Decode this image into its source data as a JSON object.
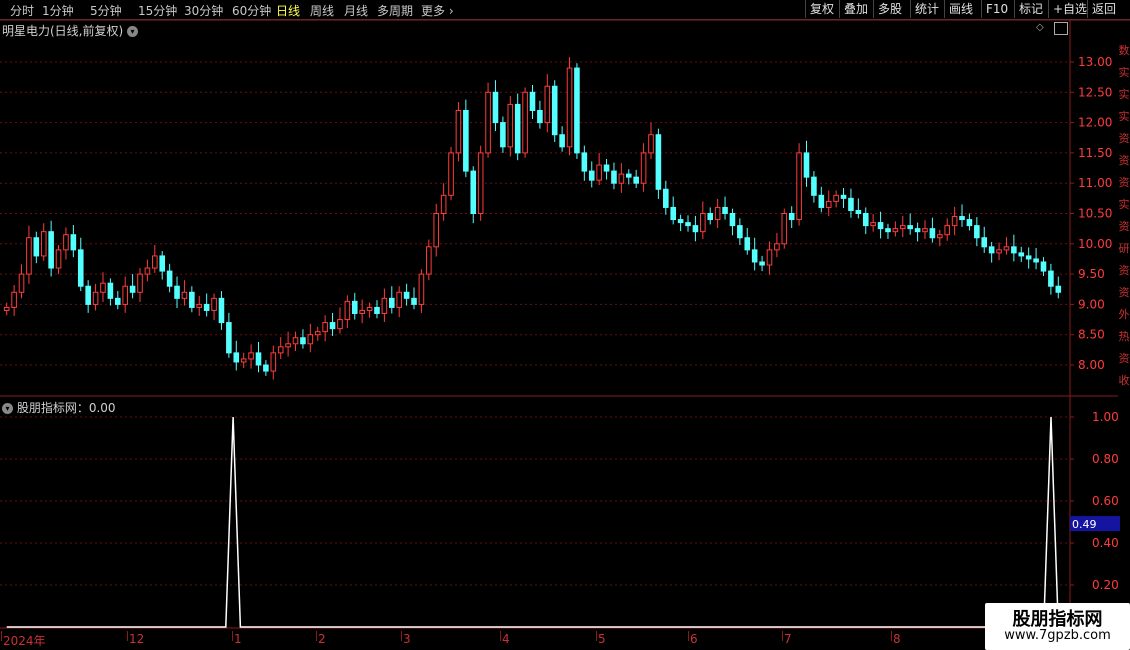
{
  "toolbar": {
    "periods": [
      "分时",
      "1分钟",
      "5分钟",
      "15分钟",
      "30分钟",
      "60分钟",
      "日线",
      "周线",
      "月线",
      "多周期",
      "更多"
    ],
    "active_period": "日线",
    "more_chevron": "›",
    "buttons": [
      "复权",
      "叠加",
      "多股",
      "统计",
      "画线",
      "F10",
      "标记",
      "+自选",
      "返回"
    ]
  },
  "main_chart": {
    "title": "明星电力(日线,前复权)",
    "price_axis": [
      "13.00",
      "12.50",
      "12.00",
      "11.50",
      "11.00",
      "10.50",
      "10.00",
      "9.50",
      "9.00",
      "8.50",
      "8.00"
    ]
  },
  "indicator": {
    "title": "股朋指标网：0.00",
    "axis": [
      "1.00",
      "0.80",
      "0.60",
      "0.40",
      "0.20"
    ],
    "cursor_value": "0.49"
  },
  "dates": [
    "2024年",
    "12",
    "1",
    "2",
    "3",
    "4",
    "5",
    "6",
    "7",
    "8"
  ],
  "watermark": {
    "line1": "股朋指标网",
    "line2": "www.7gpzb.com"
  },
  "right_strip": [
    "数",
    "实",
    "实",
    "实",
    "资",
    "资",
    "资",
    "实",
    "资",
    "研",
    "资",
    "资",
    "外",
    "热",
    "资",
    "收"
  ],
  "colors": {
    "up": "#ff3c3c",
    "down": "#54ffff",
    "grid": "#6a1010",
    "axis": "#8b1a1a",
    "signal": "#ffffff"
  },
  "chart_data": [
    {
      "type": "line",
      "series": [
        {
          "name": "close",
          "values": [
            8.95,
            9.2,
            9.5,
            10.1,
            9.8,
            10.2,
            9.6,
            9.9,
            10.15,
            9.9,
            9.3,
            9.0,
            9.2,
            9.35,
            9.1,
            9.0,
            9.3,
            9.2,
            9.5,
            9.6,
            9.8,
            9.55,
            9.3,
            9.1,
            9.2,
            8.95,
            9.0,
            8.9,
            9.1,
            8.7,
            8.2,
            8.05,
            8.1,
            8.2,
            8.0,
            7.9,
            8.2,
            8.3,
            8.35,
            8.45,
            8.35,
            8.5,
            8.55,
            8.7,
            8.6,
            8.75,
            9.05,
            8.85,
            8.9,
            8.95,
            8.85,
            9.1,
            8.95,
            9.2,
            9.1,
            9.0,
            9.5,
            9.95,
            10.5,
            10.8,
            11.5,
            12.2,
            11.2,
            10.5,
            11.5,
            12.5,
            12.0,
            11.6,
            12.3,
            11.5,
            12.5,
            12.2,
            12.0,
            12.6,
            11.8,
            11.6,
            12.9,
            11.5,
            11.2,
            11.05,
            11.3,
            11.2,
            11.0,
            11.15,
            11.1,
            11.0,
            11.5,
            11.8,
            10.9,
            10.6,
            10.4,
            10.35,
            10.3,
            10.2,
            10.5,
            10.4,
            10.6,
            10.5,
            10.3,
            10.1,
            9.9,
            9.7,
            9.65,
            9.9,
            10.0,
            10.5,
            10.4,
            11.5,
            11.1,
            10.8,
            10.6,
            10.7,
            10.8,
            10.75,
            10.55,
            10.5,
            10.3,
            10.35,
            10.25,
            10.2,
            10.25,
            10.3,
            10.25,
            10.2,
            10.25,
            10.1,
            10.15,
            10.3,
            10.45,
            10.4,
            10.3,
            10.1,
            9.95,
            9.85,
            9.9,
            9.95,
            9.85,
            9.8,
            9.75,
            9.7,
            9.55,
            9.3,
            9.2
          ]
        }
      ],
      "ylim": [
        7.8,
        13.3
      ]
    },
    {
      "type": "line",
      "series": [
        {
          "name": "股朋指标网",
          "values": [
            0,
            0,
            0,
            0,
            0,
            0,
            0,
            0,
            0,
            0,
            0,
            0,
            0,
            0,
            0,
            0,
            0,
            0,
            0,
            0,
            0,
            0,
            0,
            0,
            0,
            0,
            0,
            0,
            0,
            0,
            0,
            1,
            0,
            0,
            0,
            0,
            0,
            0,
            0,
            0,
            0,
            0,
            0,
            0,
            0,
            0,
            0,
            0,
            0,
            0,
            0,
            0,
            0,
            0,
            0,
            0,
            0,
            0,
            0,
            0,
            0,
            0,
            0,
            0,
            0,
            0,
            0,
            0,
            0,
            0,
            0,
            0,
            0,
            0,
            0,
            0,
            0,
            0,
            0,
            0,
            0,
            0,
            0,
            0,
            0,
            0,
            0,
            0,
            0,
            0,
            0,
            0,
            0,
            0,
            0,
            0,
            0,
            0,
            0,
            0,
            0,
            0,
            0,
            0,
            0,
            0,
            0,
            0,
            0,
            0,
            0,
            0,
            0,
            0,
            0,
            0,
            0,
            0,
            0,
            0,
            0,
            0,
            0,
            0,
            0,
            0,
            0,
            0,
            0,
            0,
            0,
            0,
            0,
            0,
            0,
            0,
            0,
            0,
            0,
            0,
            0,
            0,
            0,
            1,
            0
          ]
        }
      ],
      "ylim": [
        0,
        1.05
      ]
    }
  ]
}
